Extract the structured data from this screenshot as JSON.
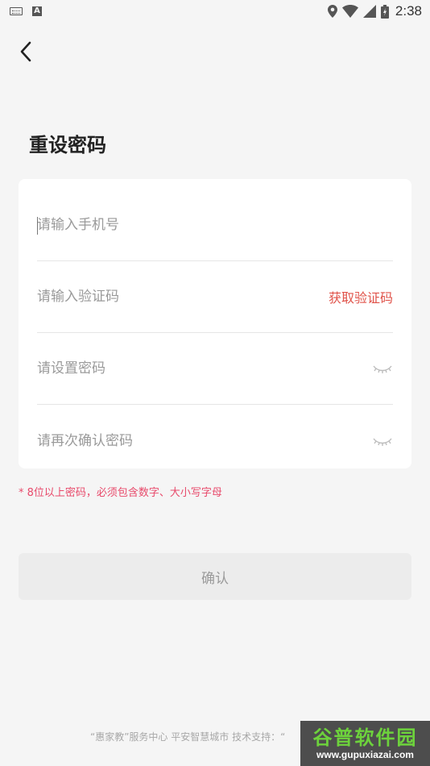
{
  "status_bar": {
    "time": "2:38",
    "icons": [
      "keyboard-icon",
      "font-a-icon",
      "location-icon",
      "wifi-icon",
      "signal-icon",
      "battery-icon"
    ]
  },
  "header": {
    "back_icon": "chevron-left-icon"
  },
  "page": {
    "title": "重设密码"
  },
  "form": {
    "phone_placeholder": "请输入手机号",
    "code_placeholder": "请输入验证码",
    "get_code_label": "获取验证码",
    "password_placeholder": "请设置密码",
    "confirm_password_placeholder": "请再次确认密码",
    "eye_icon": "eye-closed-icon",
    "hint": "* 8位以上密码，必须包含数字、大小写字母"
  },
  "actions": {
    "confirm_label": "确认"
  },
  "footer": {
    "text": "“惠家教”服务中心 平安智慧城市 技术支持：“"
  },
  "watermark": {
    "title": "谷普软件园",
    "url": "www.gupuxiazai.com"
  },
  "colors": {
    "accent": "#e0534a",
    "hint": "#e84a6b",
    "background": "#f5f5f5",
    "watermark_green": "#6dd23c"
  }
}
